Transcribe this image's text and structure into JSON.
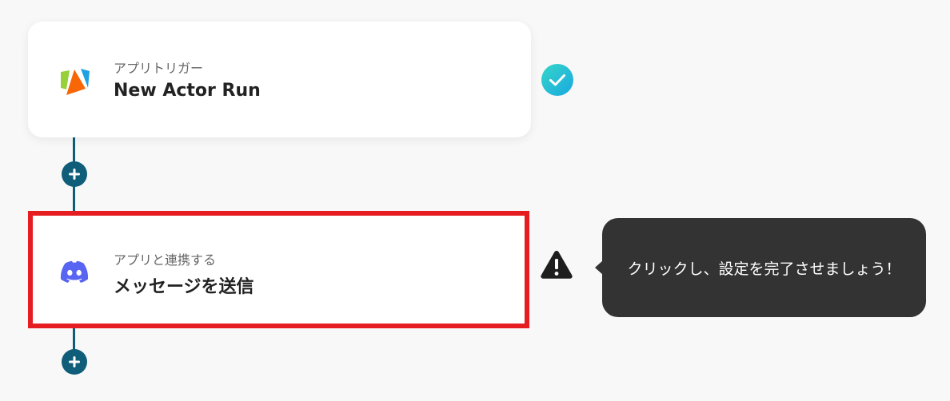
{
  "flow": {
    "trigger": {
      "subtitle": "アプリトリガー",
      "title": "New Actor Run",
      "app_icon": "apify-logo-icon",
      "status_icon": "check-circle-icon",
      "status_color": "#1fc7d4"
    },
    "action": {
      "subtitle": "アプリと連携する",
      "title": "メッセージを送信",
      "app_icon": "discord-logo-icon",
      "status_icon": "warning-icon",
      "highlight_color": "#e51d20"
    },
    "add_step_icon": "plus-icon",
    "connector_color": "#0f5d78"
  },
  "tooltip": {
    "text": "クリックし、設定を完了させましょう！"
  }
}
